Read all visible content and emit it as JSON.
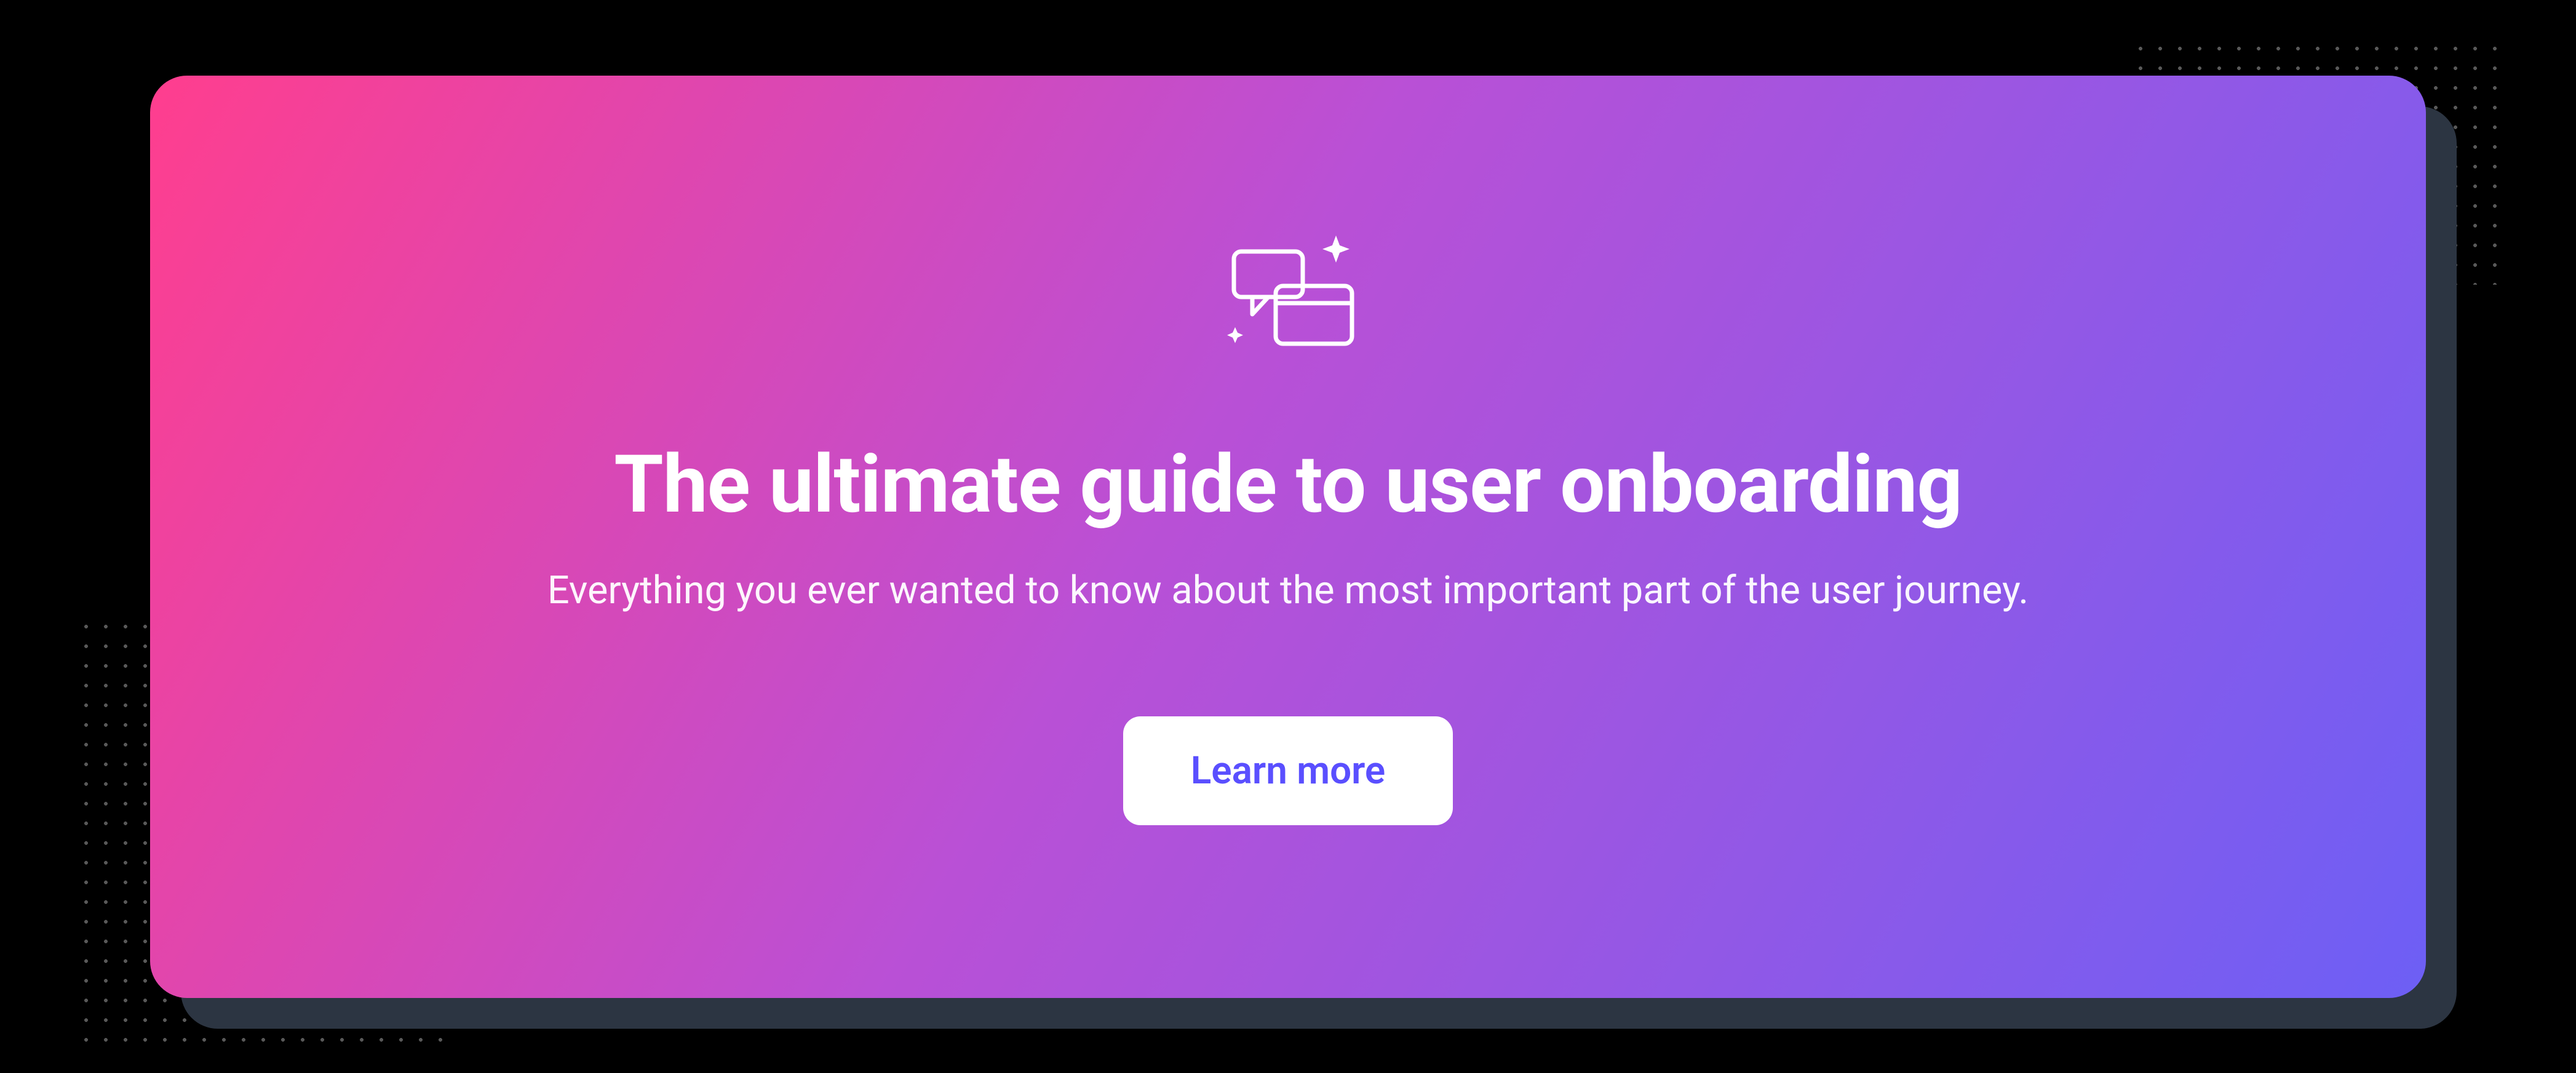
{
  "card": {
    "title": "The ultimate guide to user onboarding",
    "subtitle": "Everything you ever wanted to know about the most important part of the user journey.",
    "cta_label": "Learn more"
  },
  "colors": {
    "gradient_start": "#ff3e8e",
    "gradient_mid": "#b950d6",
    "gradient_end": "#6d5ff5",
    "button_bg": "#ffffff",
    "button_text": "#5a4fff"
  },
  "icon": {
    "name": "onboarding-chat-sparkle-icon"
  }
}
